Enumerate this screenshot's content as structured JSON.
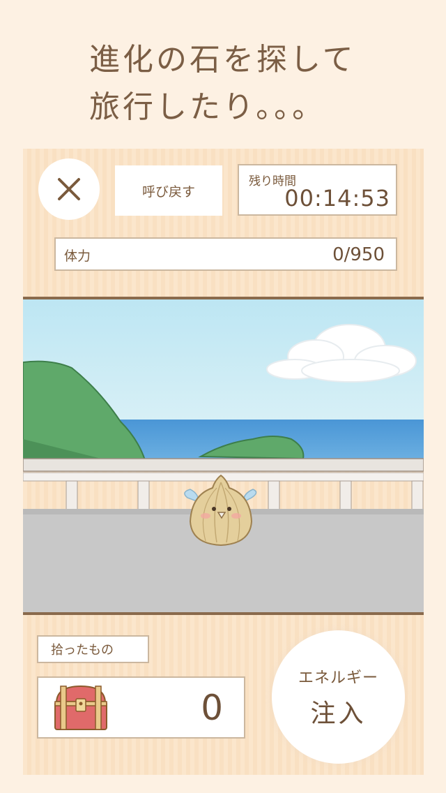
{
  "headline": {
    "line1": "進化の石を探して",
    "line2": "旅行したり。。。"
  },
  "header": {
    "close_icon": "close-icon",
    "recall_label": "呼び戻す",
    "timer_label": "残り時間",
    "timer_value": "00:14:53"
  },
  "stamina": {
    "label": "体力",
    "value": "0/950"
  },
  "found": {
    "label": "拾ったもの",
    "icon": "treasure-chest-icon",
    "count": "0"
  },
  "energy_button": {
    "small": "エネルギー",
    "big": "注入"
  },
  "colors": {
    "background": "#fdf1e3",
    "panel": "#fbe6cc",
    "text": "#7a5a3c",
    "border": "#cbb79f",
    "sea": "#3e8fd4",
    "sky": "#bfe6f2"
  }
}
